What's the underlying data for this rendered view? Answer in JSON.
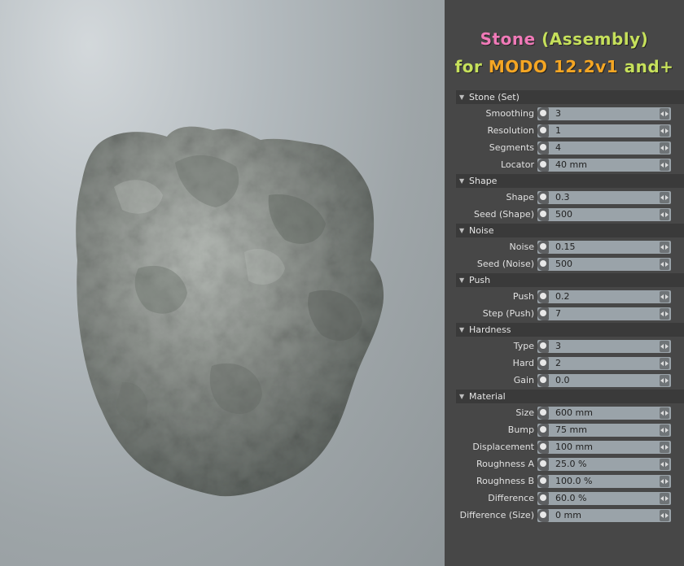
{
  "title": {
    "line1_word1": "Stone",
    "line1_word2": "(Assembly)",
    "line2_for": "for",
    "line2_app": "MODO",
    "line2_version": "12.2v1",
    "line2_suffix": "and+"
  },
  "sections": [
    {
      "label": "Stone (Set)",
      "rows": [
        {
          "label": "Smoothing",
          "value": "3"
        },
        {
          "label": "Resolution",
          "value": "1"
        },
        {
          "label": "Segments",
          "value": "4"
        },
        {
          "label": "Locator",
          "value": "40 mm"
        }
      ]
    },
    {
      "label": "Shape",
      "rows": [
        {
          "label": "Shape",
          "value": "0.3"
        },
        {
          "label": "Seed (Shape)",
          "value": "500"
        }
      ]
    },
    {
      "label": "Noise",
      "rows": [
        {
          "label": "Noise",
          "value": "0.15"
        },
        {
          "label": "Seed (Noise)",
          "value": "500"
        }
      ]
    },
    {
      "label": "Push",
      "rows": [
        {
          "label": "Push",
          "value": "0.2"
        },
        {
          "label": "Step (Push)",
          "value": "7"
        }
      ]
    },
    {
      "label": "Hardness",
      "rows": [
        {
          "label": "Type",
          "value": "3"
        },
        {
          "label": "Hard",
          "value": "2"
        },
        {
          "label": "Gain",
          "value": "0.0"
        }
      ]
    },
    {
      "label": "Material",
      "rows": [
        {
          "label": "Size",
          "value": "600 mm"
        },
        {
          "label": "Bump",
          "value": "75 mm"
        },
        {
          "label": "Displacement",
          "value": "100 mm"
        },
        {
          "label": "Roughness A",
          "value": "25.0 %"
        },
        {
          "label": "Roughness B",
          "value": "100.0 %"
        },
        {
          "label": "Difference",
          "value": "60.0 %"
        },
        {
          "label": "Difference (Size)",
          "value": "0 mm"
        }
      ]
    }
  ],
  "colors": {
    "pink": "#f07ab8",
    "orange": "#f5a623",
    "green": "#c6e05b"
  }
}
